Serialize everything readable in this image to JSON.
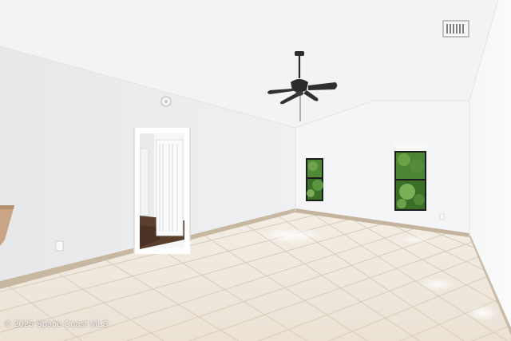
{
  "watermark": {
    "text": "© 2025 Space Coast MLS"
  },
  "colors": {
    "ceiling": "#f2f3f4",
    "wall_left": "#eceeef",
    "wall_back": "#f4f5f6",
    "wall_right": "#f7f8f8",
    "floor_tile": "#efe7dc",
    "grout": "#ddd2c4",
    "baseboard": "#c9b9a4",
    "hallway_floor": "#5a3f2c",
    "fan": "#2a2c2e",
    "foliage": "#3f7a2e"
  },
  "icons": {
    "fan": "ceiling-fan-icon",
    "vent": "air-vent-icon",
    "detector": "smoke-detector-icon"
  }
}
